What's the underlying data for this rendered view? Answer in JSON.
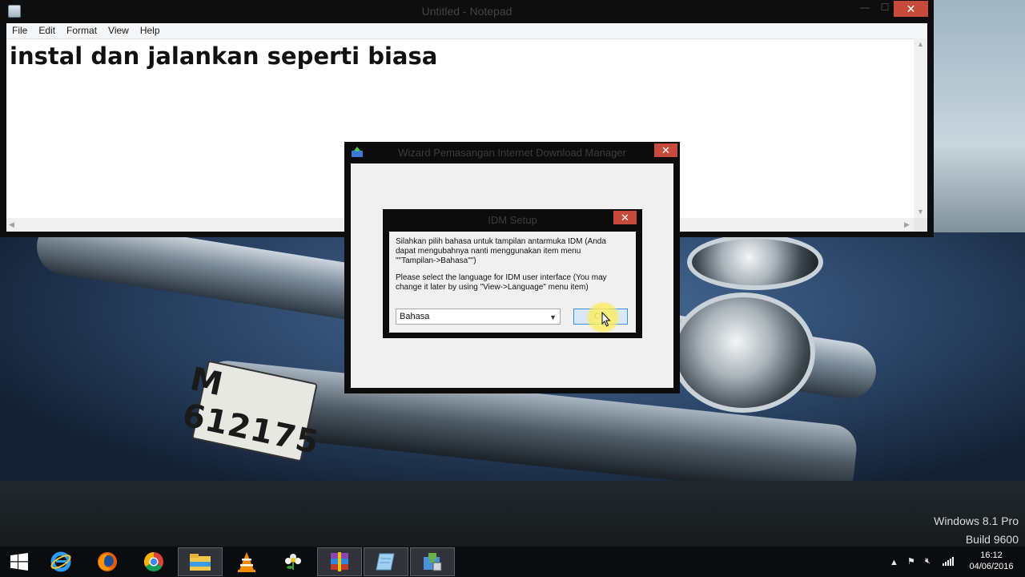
{
  "notepad": {
    "title": "Untitled - Notepad",
    "window_controls": {
      "minimize": "—",
      "maximize": "☐",
      "close": "✕"
    },
    "menu": [
      "File",
      "Edit",
      "Format",
      "View",
      "Help"
    ],
    "content": "instal dan jalankan seperti biasa"
  },
  "wizard": {
    "title": "Wizard Pemasangan Internet Download Manager",
    "close": "✕"
  },
  "setup_dialog": {
    "title": "IDM Setup",
    "close": "✕",
    "message_id": "Silahkan pilih bahasa untuk tampilan antarmuka IDM (Anda\ndapat mengubahnya nanti menggunakan item menu\n\"\"Tampilan->Bahasa\"\")",
    "message_en": "Please select the language for IDM user interface (You may\nchange it later by using \"View->Language\" menu item)",
    "language_select": "Bahasa",
    "ok_button": "OK"
  },
  "wallpaper": {
    "license_plate": "M 612175"
  },
  "watermark": {
    "edition": "Windows 8.1 Pro",
    "build": "Build 9600"
  },
  "taskbar": {
    "apps": [
      {
        "name": "internet-explorer-icon",
        "active": false
      },
      {
        "name": "firefox-icon",
        "active": false
      },
      {
        "name": "chrome-icon",
        "active": false
      },
      {
        "name": "file-explorer-icon",
        "active": true
      },
      {
        "name": "vlc-icon",
        "active": false
      },
      {
        "name": "flower-app-icon",
        "active": false
      },
      {
        "name": "winrar-icon",
        "active": true
      },
      {
        "name": "notepad-icon",
        "active": true
      },
      {
        "name": "installer-icon",
        "active": true
      }
    ],
    "clock": {
      "time": "16:12",
      "date": "04/06/2016"
    }
  },
  "colors": {
    "close_red": "#c74b3b",
    "ok_border": "#3c8fd6",
    "ok_fill": "#d9e8f6",
    "dialog_bg": "#f0f0f0"
  }
}
